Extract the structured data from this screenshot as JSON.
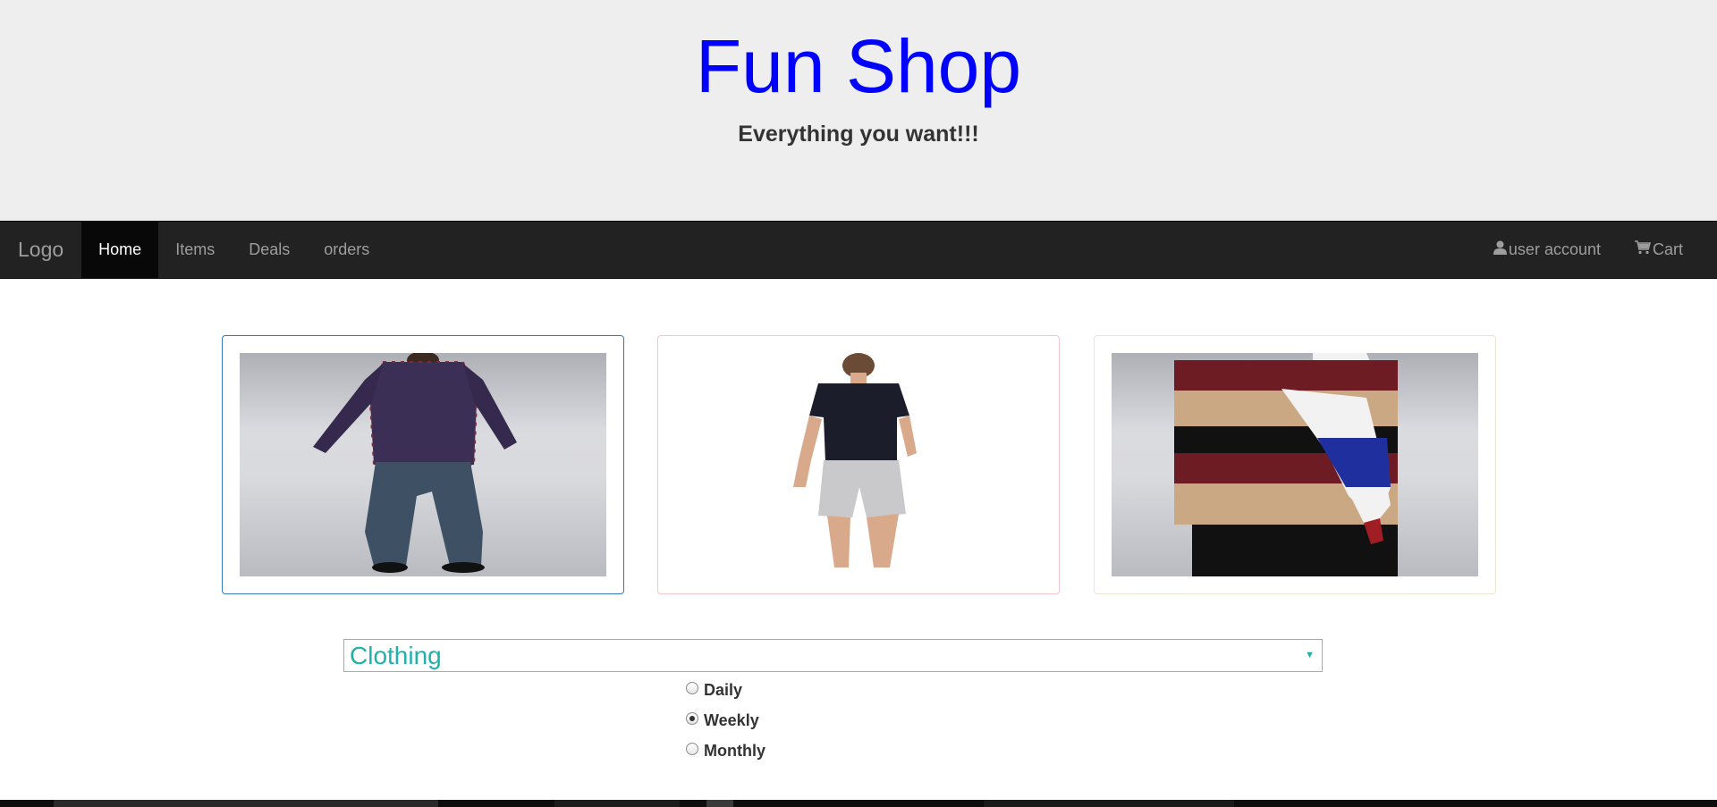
{
  "header": {
    "title": "Fun Shop",
    "tagline": "Everything you want!!!",
    "title_color": "#0000ff"
  },
  "navbar": {
    "brand": "Logo",
    "items": [
      {
        "label": "Home",
        "active": true
      },
      {
        "label": "Items",
        "active": false
      },
      {
        "label": "Deals",
        "active": false
      },
      {
        "label": "orders",
        "active": false
      }
    ],
    "right_items": [
      {
        "label": "user account",
        "icon": "user-icon"
      },
      {
        "label": "Cart",
        "icon": "cart-icon"
      }
    ]
  },
  "products": [
    {
      "image": "man-plaid-shirt-jeans-back",
      "border_color": "#337ab7"
    },
    {
      "image": "man-tshirt-shorts-back",
      "border_color": "#f2c6cf"
    },
    {
      "image": "striped-rugby-sweater-back",
      "border_color": "#ece4cf"
    }
  ],
  "filter": {
    "category_selected": "Clothing",
    "category_color": "#20b2aa",
    "frequency_options": [
      {
        "label": "Daily",
        "checked": false
      },
      {
        "label": "Weekly",
        "checked": true
      },
      {
        "label": "Monthly",
        "checked": false
      }
    ]
  }
}
